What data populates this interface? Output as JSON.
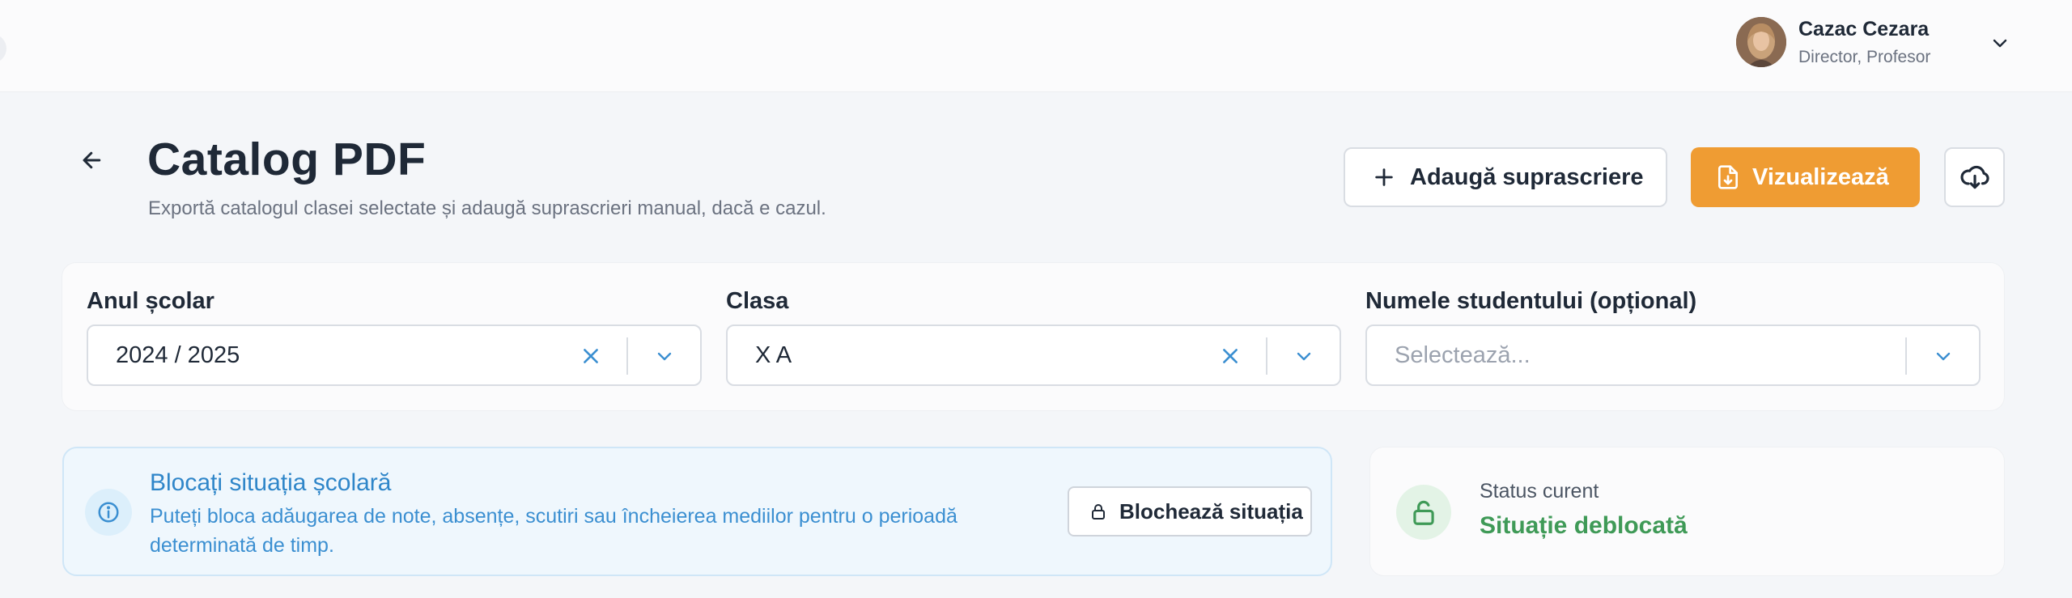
{
  "header": {
    "user_name": "Cazac Cezara",
    "user_role": "Director, Profesor",
    "avatar_icon": "user-avatar-photo",
    "menu_icon": "chevron-down-icon"
  },
  "page": {
    "title": "Catalog PDF",
    "subtitle": "Exportă catalogul clasei selectate și adaugă suprascrieri manual, dacă e cazul.",
    "back_icon": "arrow-left-icon"
  },
  "actions": {
    "add_override_label": "Adaugă suprascriere",
    "view_label": "Vizualizează",
    "download_icon": "cloud-download-icon"
  },
  "filters": {
    "year": {
      "label": "Anul școlar",
      "value": "2024 / 2025"
    },
    "class": {
      "label": "Clasa",
      "value": "X A"
    },
    "student": {
      "label": "Numele studentului (opțional)",
      "placeholder": "Selectează..."
    }
  },
  "lock_panel": {
    "title": "Blocați situația școlară",
    "description": "Puteți bloca adăugarea de note, absențe, scutiri sau încheierea mediilor pentru o perioadă determinată de timp.",
    "button_label": "Blochează situația"
  },
  "status": {
    "label": "Status curent",
    "value": "Situație deblocată"
  },
  "colors": {
    "accent": "#ef9c33",
    "info": "#2f86c9",
    "success": "#3f9a57",
    "clear_x": "#3b8fd1"
  }
}
